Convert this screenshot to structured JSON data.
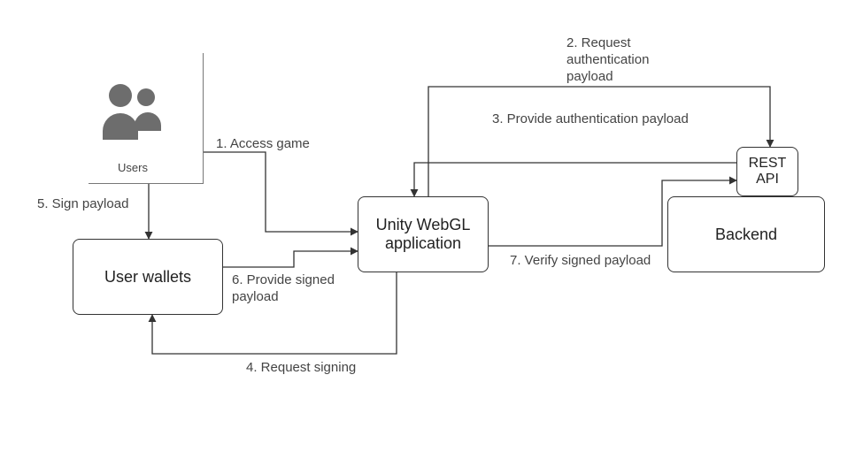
{
  "nodes": {
    "users_caption": "Users",
    "user_wallets": "User wallets",
    "unity_webgl": "Unity WebGL\napplication",
    "rest_api": "REST\nAPI",
    "backend": "Backend"
  },
  "edges": {
    "access_game": "1. Access game",
    "request_auth_payload": "2. Request\nauthentication\npayload",
    "provide_auth_payload": "3. Provide authentication payload",
    "request_signing": "4. Request signing",
    "sign_payload": "5. Sign payload",
    "provide_signed_payload": "6. Provide signed\npayload",
    "verify_signed_payload": "7. Verify signed payload"
  }
}
